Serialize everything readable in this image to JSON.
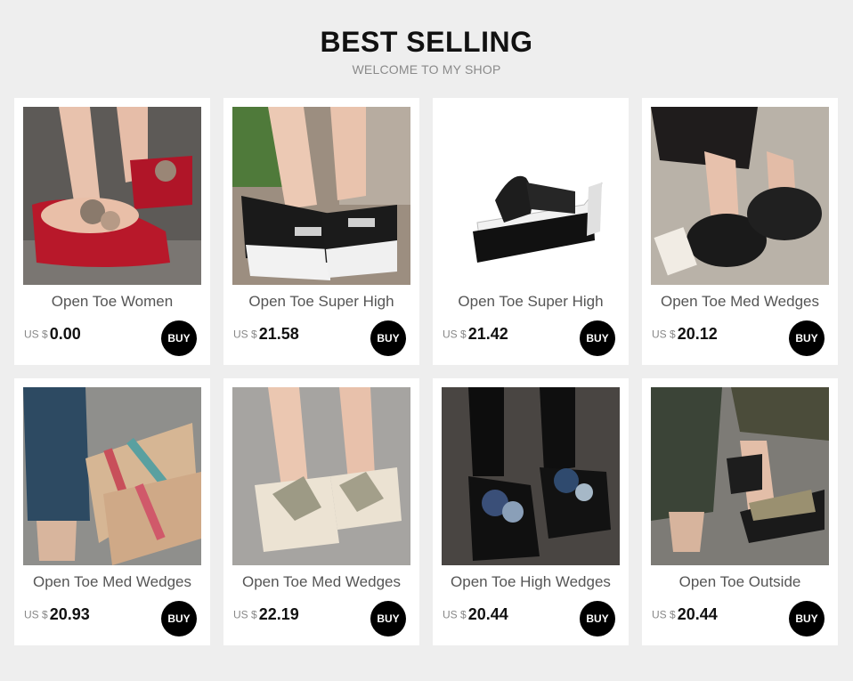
{
  "header": {
    "title": "BEST SELLING",
    "subtitle": "WELCOME TO MY SHOP"
  },
  "products": [
    {
      "name": "Open Toe Women",
      "currency": "US $",
      "price": "0.00",
      "buy": "BUY",
      "image": "red-platform-flower-flip-flop-photo"
    },
    {
      "name": "Open Toe Super High",
      "currency": "US $",
      "price": "21.58",
      "buy": "BUY",
      "image": "black-white-wedge-slipper-photo"
    },
    {
      "name": "Open Toe Super High",
      "currency": "US $",
      "price": "21.42",
      "buy": "BUY",
      "image": "black-wedge-flip-flop-photo"
    },
    {
      "name": "Open Toe Med Wedges",
      "currency": "US $",
      "price": "20.12",
      "buy": "BUY",
      "image": "black-fur-slipper-photo"
    },
    {
      "name": "Open Toe Med Wedges",
      "currency": "US $",
      "price": "20.93",
      "buy": "BUY",
      "image": "colorful-strap-flip-flop-photo"
    },
    {
      "name": "Open Toe Med Wedges",
      "currency": "US $",
      "price": "22.19",
      "buy": "BUY",
      "image": "beige-bow-slipper-photo"
    },
    {
      "name": "Open Toe High Wedges",
      "currency": "US $",
      "price": "20.44",
      "buy": "BUY",
      "image": "black-flower-platform-slipper-photo"
    },
    {
      "name": "Open Toe Outside",
      "currency": "US $",
      "price": "20.44",
      "buy": "BUY",
      "image": "glitter-platform-flip-flop-photo"
    }
  ],
  "colors": {
    "background": "#eeeeee",
    "card": "#ffffff",
    "buy_button": "#000000",
    "title": "#111111",
    "subtitle": "#8a8a8a"
  }
}
